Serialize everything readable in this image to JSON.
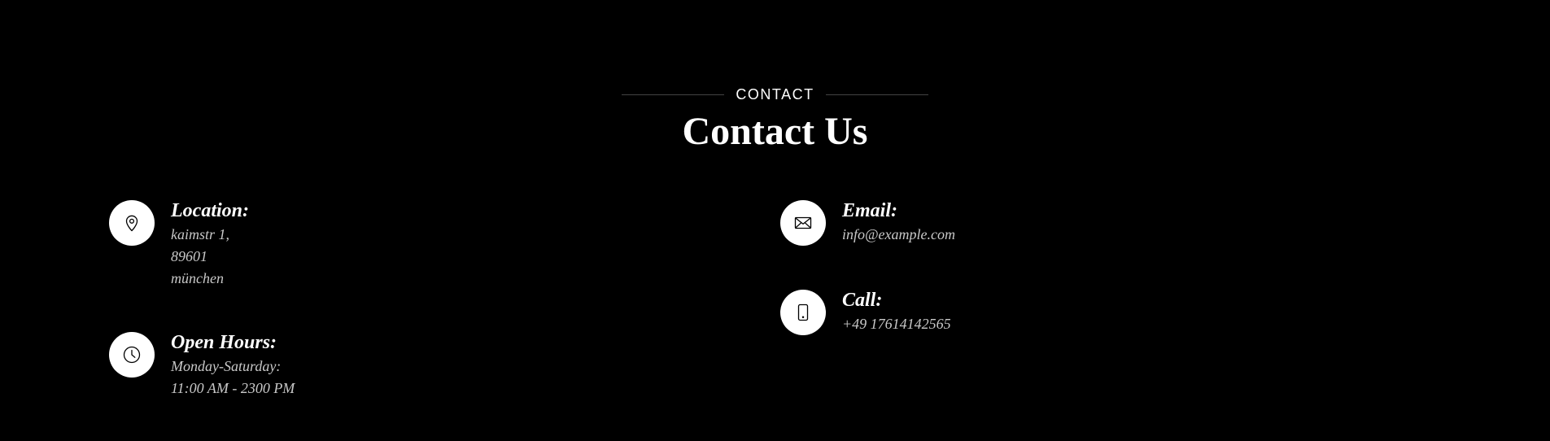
{
  "section": {
    "eyebrow": "CONTACT",
    "title": "Contact Us"
  },
  "contact_items": {
    "location": {
      "icon": "location-pin-icon",
      "title": "Location:",
      "lines": [
        "kaimstr 1,",
        "89601",
        "münchen"
      ]
    },
    "hours": {
      "icon": "clock-icon",
      "title": "Open Hours:",
      "lines": [
        "Monday-Saturday:",
        "11:00 AM - 2300 PM"
      ]
    },
    "email": {
      "icon": "envelope-icon",
      "title": "Email:",
      "lines": [
        "info@example.com"
      ]
    },
    "call": {
      "icon": "mobile-phone-icon",
      "title": "Call:",
      "lines": [
        "+49 17614142565"
      ]
    }
  },
  "colors": {
    "background": "#000000",
    "text": "#ffffff",
    "muted_text": "#c8c8c8",
    "icon_circle": "#ffffff",
    "icon_stroke": "#000000"
  }
}
